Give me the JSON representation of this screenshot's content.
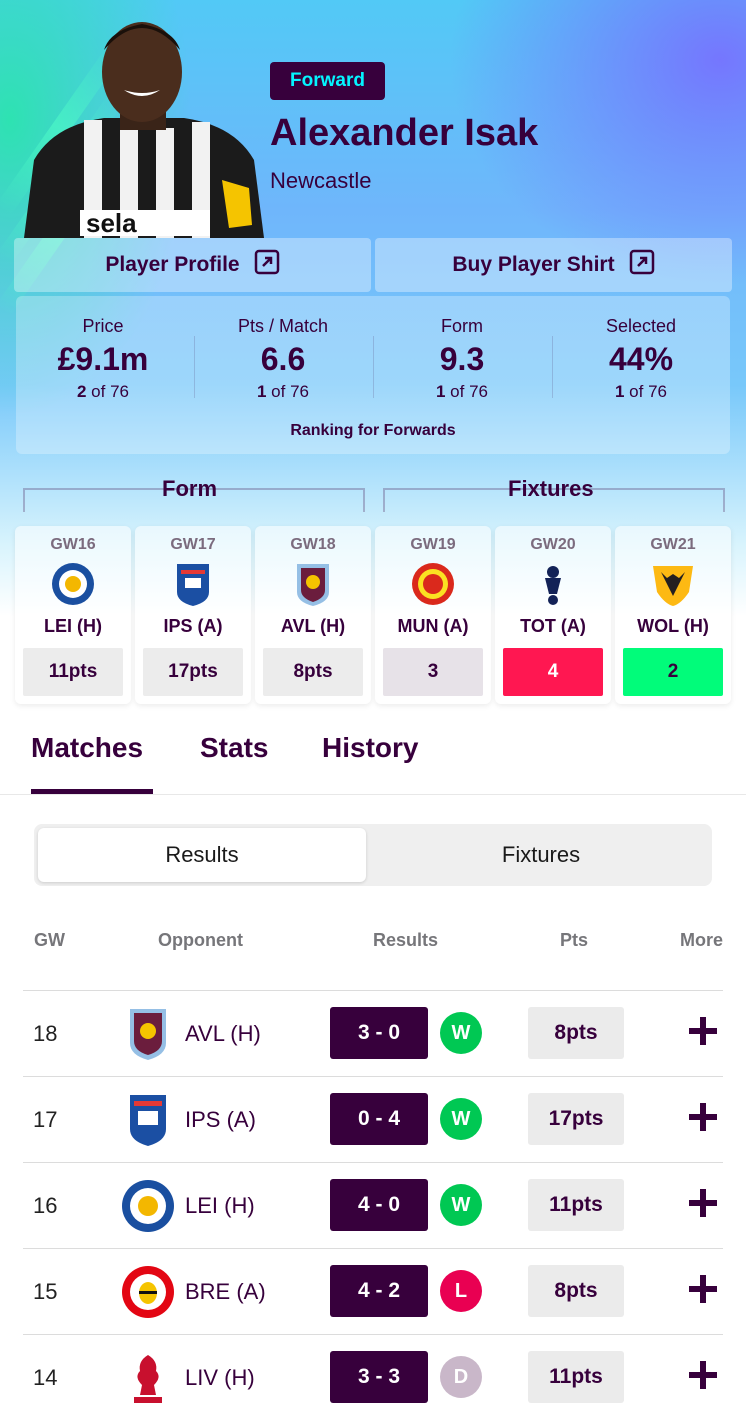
{
  "player": {
    "position": "Forward",
    "name": "Alexander Isak",
    "club": "Newcastle"
  },
  "links": {
    "profile": "Player Profile",
    "shirt": "Buy Player Shirt"
  },
  "stats": [
    {
      "label": "Price",
      "value": "£9.1m",
      "rank_num": "2",
      "rank_rest": " of 76"
    },
    {
      "label": "Pts / Match",
      "value": "6.6",
      "rank_num": "1",
      "rank_rest": " of 76"
    },
    {
      "label": "Form",
      "value": "9.3",
      "rank_num": "1",
      "rank_rest": " of 76"
    },
    {
      "label": "Selected",
      "value": "44%",
      "rank_num": "1",
      "rank_rest": " of 76"
    }
  ],
  "ranking_caption": "Ranking for Forwards",
  "form_title": "Form",
  "fixtures_title": "Fixtures",
  "gameweeks": [
    {
      "gw": "GW16",
      "opp": "LEI (H)",
      "pts": "11pts",
      "kind": "form",
      "crest": "leicester-crest"
    },
    {
      "gw": "GW17",
      "opp": "IPS (A)",
      "pts": "17pts",
      "kind": "form",
      "crest": "ipswich-crest"
    },
    {
      "gw": "GW18",
      "opp": "AVL (H)",
      "pts": "8pts",
      "kind": "form",
      "crest": "aston-villa-crest"
    },
    {
      "gw": "GW19",
      "opp": "MUN (A)",
      "pts": "3",
      "kind": "fixture",
      "fdr_color": "#e7e2e8",
      "fdr_text": "#37003c",
      "crest": "man-utd-crest"
    },
    {
      "gw": "GW20",
      "opp": "TOT (A)",
      "pts": "4",
      "kind": "fixture",
      "fdr_color": "#ff1751",
      "fdr_text": "#ffffff",
      "crest": "tottenham-crest"
    },
    {
      "gw": "GW21",
      "opp": "WOL (H)",
      "pts": "2",
      "kind": "fixture",
      "fdr_color": "#01fc7a",
      "fdr_text": "#37003c",
      "crest": "wolves-crest"
    }
  ],
  "tabs": [
    "Matches",
    "Stats",
    "History"
  ],
  "segment": {
    "active": "Results",
    "inactive": "Fixtures"
  },
  "table_headers": [
    "GW",
    "Opponent",
    "Results",
    "Pts",
    "More"
  ],
  "results": [
    {
      "gw": "18",
      "opp": "AVL (H)",
      "score": "3 - 0",
      "res": "W",
      "res_color": "#00c853",
      "pts": "8pts",
      "crest": "aston-villa-crest"
    },
    {
      "gw": "17",
      "opp": "IPS (A)",
      "score": "0 - 4",
      "res": "W",
      "res_color": "#00c853",
      "pts": "17pts",
      "crest": "ipswich-crest"
    },
    {
      "gw": "16",
      "opp": "LEI (H)",
      "score": "4 - 0",
      "res": "W",
      "res_color": "#00c853",
      "pts": "11pts",
      "crest": "leicester-crest"
    },
    {
      "gw": "15",
      "opp": "BRE (A)",
      "score": "4 - 2",
      "res": "L",
      "res_color": "#e90052",
      "pts": "8pts",
      "crest": "brentford-crest"
    },
    {
      "gw": "14",
      "opp": "LIV (H)",
      "score": "3 - 3",
      "res": "D",
      "res_color": "#c9b7c9",
      "pts": "11pts",
      "crest": "liverpool-crest"
    }
  ],
  "colors": {
    "primary": "#37003c",
    "accent": "#04f5ff"
  }
}
